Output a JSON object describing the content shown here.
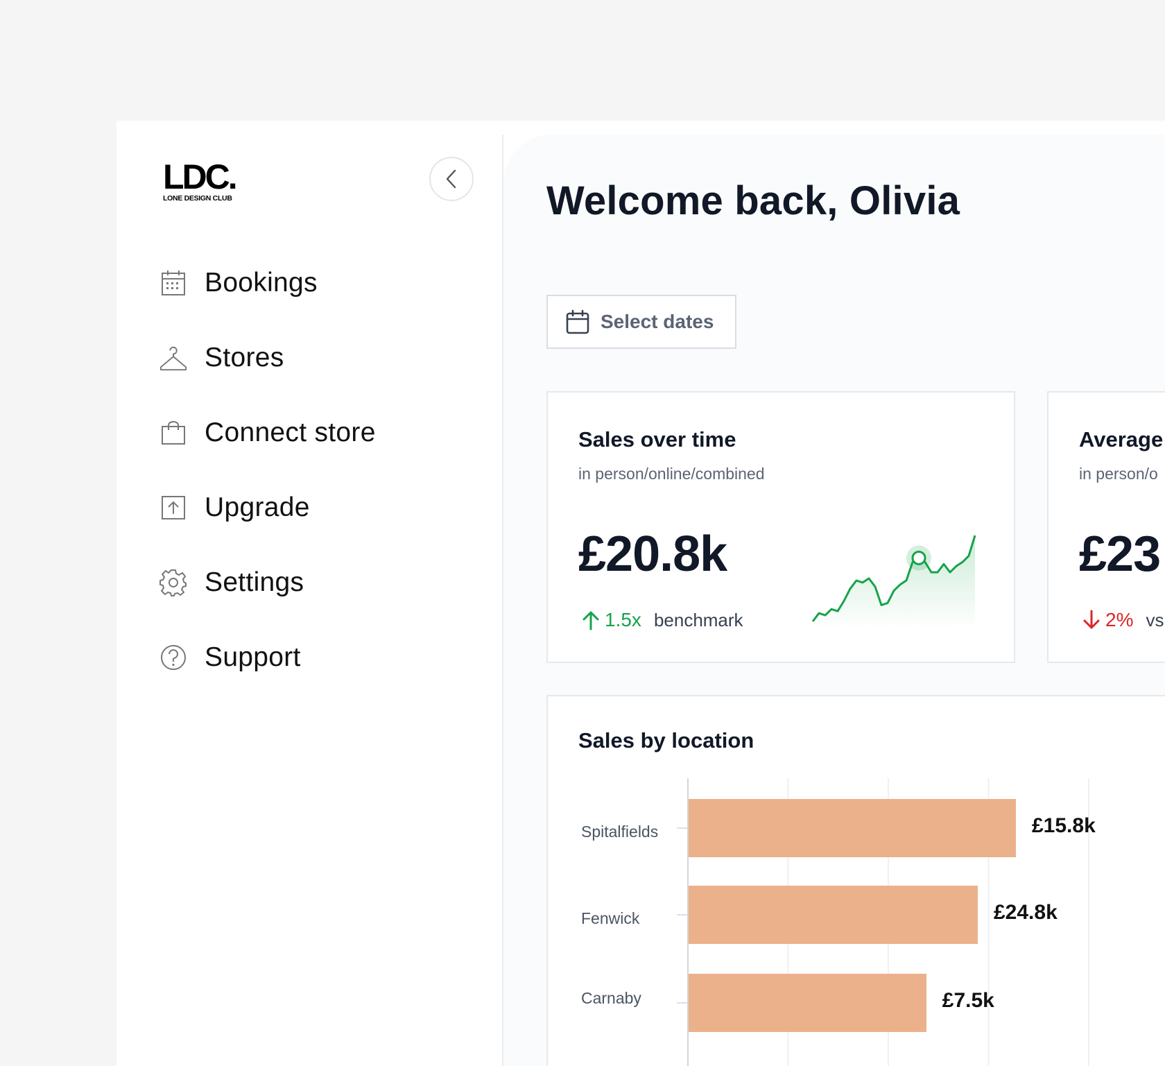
{
  "brand": {
    "logo_mark": "LDC.",
    "logo_sub": "LONE DESIGN CLUB"
  },
  "sidebar": {
    "items": [
      {
        "label": "Bookings",
        "icon": "calendar-icon"
      },
      {
        "label": "Stores",
        "icon": "hanger-icon"
      },
      {
        "label": "Connect store",
        "icon": "shopping-bag-icon"
      },
      {
        "label": "Upgrade",
        "icon": "upload-icon"
      },
      {
        "label": "Settings",
        "icon": "gear-icon"
      },
      {
        "label": "Support",
        "icon": "help-icon"
      }
    ]
  },
  "main": {
    "title": "Welcome back, Olivia",
    "select_dates_label": "Select dates"
  },
  "cards": {
    "sales_over_time": {
      "title": "Sales over time",
      "subtitle": "in person/online/combined",
      "value": "£20.8k",
      "trend_value": "1.5x",
      "trend_text": "benchmark",
      "trend_direction": "up"
    },
    "average": {
      "title": "Average",
      "subtitle": "in person/o",
      "value": "£23",
      "trend_value": "2%",
      "trend_text": "vs",
      "trend_direction": "down"
    }
  },
  "colors": {
    "positive": "#16a34a",
    "negative": "#dc2626",
    "bar": "#ebb18b",
    "text_primary": "#111827"
  },
  "chart_data": [
    {
      "type": "line",
      "y": [
        2,
        6,
        5,
        8,
        7,
        12,
        18,
        22,
        21,
        23,
        19,
        10,
        11,
        17,
        20,
        22,
        31,
        33,
        31,
        26,
        26,
        30,
        26,
        29,
        31,
        34,
        44
      ],
      "highlight_index": 17,
      "title": "",
      "grid": false
    },
    {
      "type": "bar",
      "orientation": "horizontal",
      "title": "Sales by location",
      "categories": [
        "Spitalfields",
        "Fenwick",
        "Carnaby"
      ],
      "values": [
        15.8,
        24.8,
        7.5
      ],
      "value_labels": [
        "£15.8k",
        "£24.8k",
        "£7.5k"
      ],
      "grid": true
    }
  ]
}
